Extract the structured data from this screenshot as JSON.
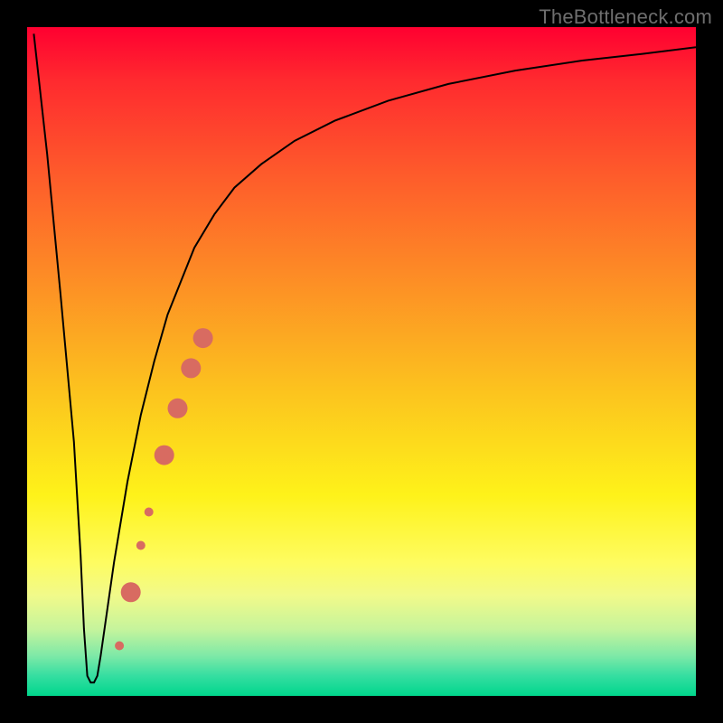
{
  "attribution": "TheBottleneck.com",
  "chart_data": {
    "type": "line",
    "title": "",
    "xlabel": "",
    "ylabel": "",
    "xlim": [
      0,
      100
    ],
    "ylim": [
      0,
      100
    ],
    "background_gradient": {
      "top": "#ff0030",
      "mid": "#fcc51e",
      "low_band": "#fefc60",
      "bottom": "#00d68c"
    },
    "curve_stroke": "#000000",
    "curve_stroke_width": 2,
    "series": [
      {
        "name": "bottleneck-curve",
        "x": [
          1,
          3,
          5,
          7,
          8,
          8.5,
          9,
          9.5,
          10,
          10.5,
          11,
          12,
          13,
          15,
          17,
          19,
          21,
          23,
          25,
          28,
          31,
          35,
          40,
          46,
          54,
          63,
          73,
          83,
          92,
          100
        ],
        "y": [
          99,
          81,
          60,
          38,
          21,
          10,
          3,
          2,
          2,
          3,
          6,
          13,
          20,
          32,
          42,
          50,
          57,
          62,
          67,
          72,
          76,
          79.5,
          83,
          86,
          89,
          91.5,
          93.5,
          95,
          96,
          97
        ]
      }
    ],
    "markers": {
      "name": "highlight-segment",
      "color": "#d86b61",
      "points": [
        {
          "x": 13.8,
          "y": 7.5,
          "r": 5
        },
        {
          "x": 15.5,
          "y": 15.5,
          "r": 11
        },
        {
          "x": 17.0,
          "y": 22.5,
          "r": 5
        },
        {
          "x": 18.2,
          "y": 27.5,
          "r": 5
        },
        {
          "x": 20.5,
          "y": 36.0,
          "r": 11
        },
        {
          "x": 22.5,
          "y": 43.0,
          "r": 11
        },
        {
          "x": 24.5,
          "y": 49.0,
          "r": 11
        },
        {
          "x": 26.3,
          "y": 53.5,
          "r": 11
        }
      ]
    }
  }
}
